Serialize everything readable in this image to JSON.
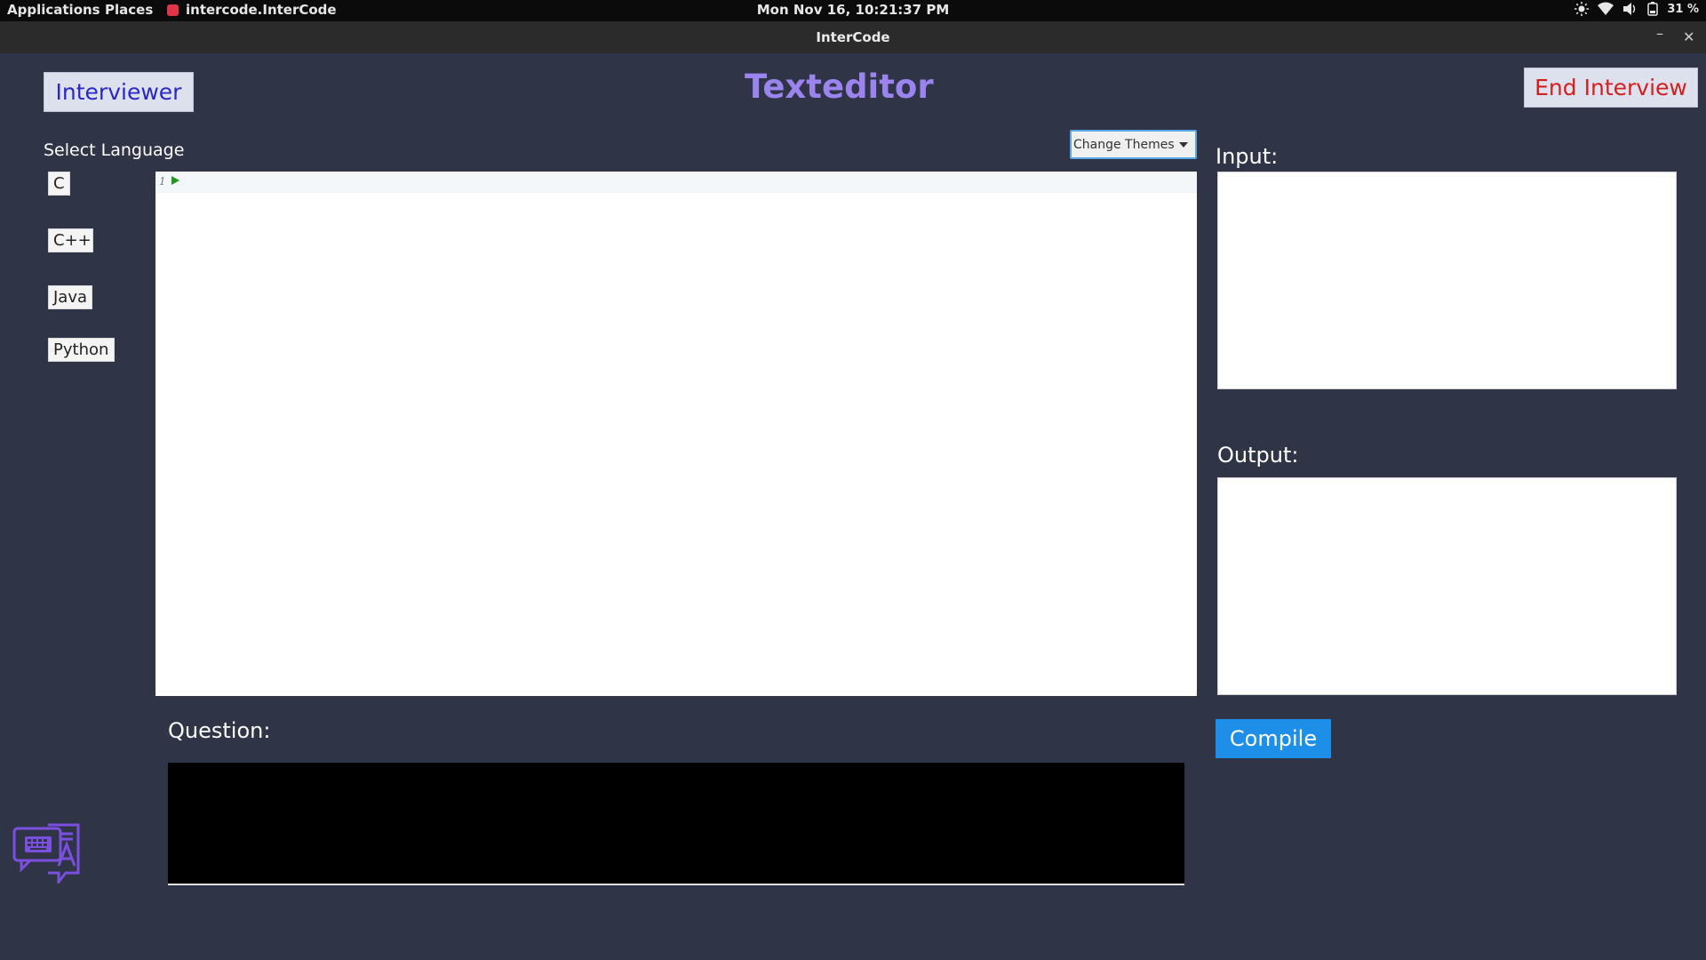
{
  "topbar": {
    "applications": "Applications",
    "places": "Places",
    "window_name": "intercode.InterCode",
    "clock": "Mon Nov 16, 10:21:37 PM",
    "battery": "31 %",
    "tray_icons": [
      "brightness-icon",
      "wifi-icon",
      "volume-icon",
      "battery-icon"
    ]
  },
  "window": {
    "title": "InterCode",
    "minimize_label": "–",
    "close_label": "✕"
  },
  "app": {
    "interviewer_button": "Interviewer",
    "title": "Texteditor",
    "end_button": "End Interview",
    "select_language_label": "Select Language",
    "languages": [
      "C",
      "C++",
      "Java",
      "Python"
    ],
    "theme_select": "Change Themes",
    "editor": {
      "line_numbers": [
        "1"
      ],
      "content": ""
    },
    "input_label": "Input:",
    "input_value": "",
    "output_label": "Output:",
    "output_value": "",
    "compile_button": "Compile",
    "question_label": "Question:",
    "question_text": ""
  },
  "colors": {
    "background": "#2f3447",
    "title": "#9b84ee",
    "interviewer_text": "#2a27c8",
    "end_text": "#d3201f",
    "compile_bg": "#1e8fe8",
    "logo": "#7b4fe0"
  }
}
